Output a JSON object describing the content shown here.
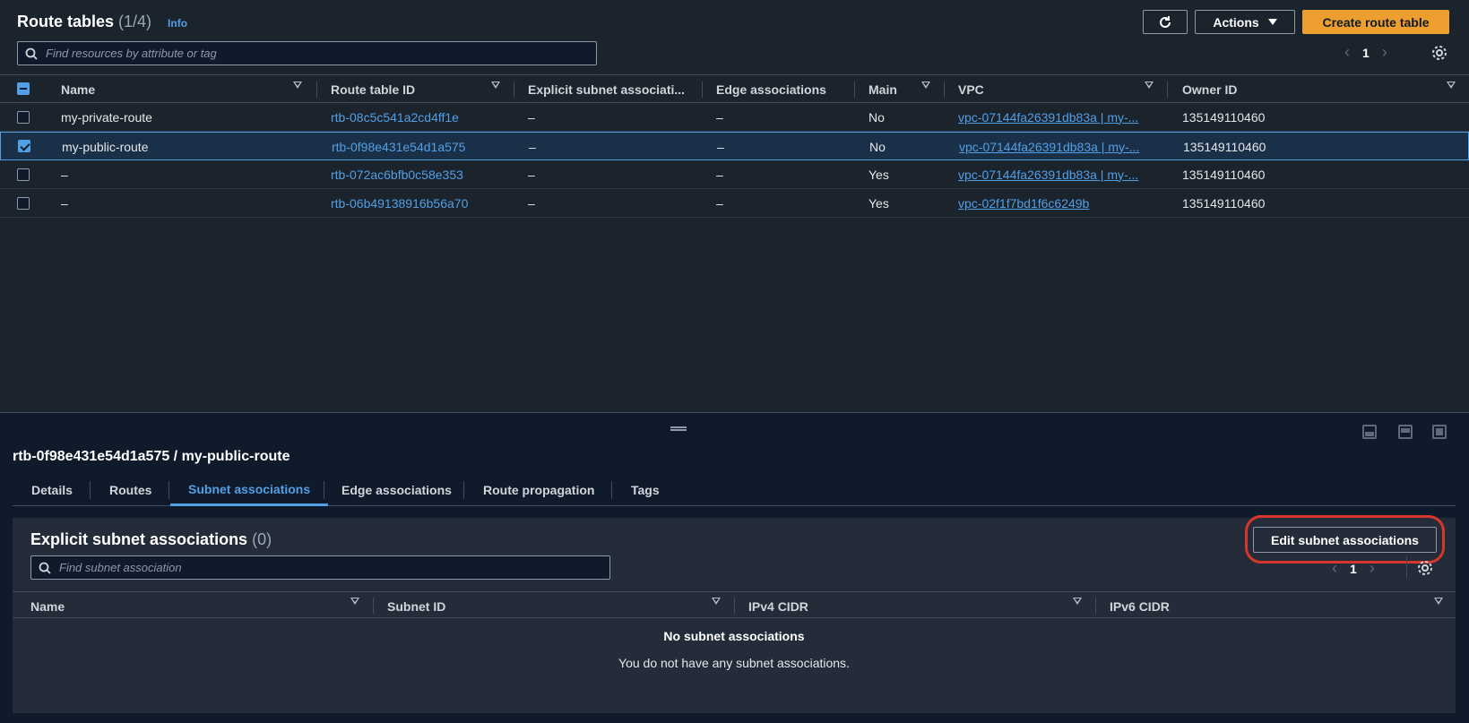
{
  "header": {
    "title": "Route tables",
    "count": "(1/4)",
    "info": "Info",
    "actions_label": "Actions",
    "create_label": "Create route table",
    "search_placeholder": "Find resources by attribute or tag",
    "page_number": "1"
  },
  "table": {
    "columns": [
      "Name",
      "Route table ID",
      "Explicit subnet associati...",
      "Edge associations",
      "Main",
      "VPC",
      "Owner ID"
    ],
    "rows": [
      {
        "name": "my-private-route",
        "id": "rtb-08c5c541a2cd4ff1e",
        "explicit": "–",
        "edge": "–",
        "main": "No",
        "vpc": "vpc-07144fa26391db83a | my-...",
        "owner": "135149110460",
        "selected": false
      },
      {
        "name": "my-public-route",
        "id": "rtb-0f98e431e54d1a575",
        "explicit": "–",
        "edge": "–",
        "main": "No",
        "vpc": "vpc-07144fa26391db83a | my-...",
        "owner": "135149110460",
        "selected": true
      },
      {
        "name": "–",
        "id": "rtb-072ac6bfb0c58e353",
        "explicit": "–",
        "edge": "–",
        "main": "Yes",
        "vpc": "vpc-07144fa26391db83a | my-...",
        "owner": "135149110460",
        "selected": false
      },
      {
        "name": "–",
        "id": "rtb-06b49138916b56a70",
        "explicit": "–",
        "edge": "–",
        "main": "Yes",
        "vpc": "vpc-02f1f7bd1f6c6249b",
        "owner": "135149110460",
        "selected": false
      }
    ]
  },
  "detail": {
    "title": "rtb-0f98e431e54d1a575 / my-public-route",
    "tabs": [
      "Details",
      "Routes",
      "Subnet associations",
      "Edge associations",
      "Route propagation",
      "Tags"
    ],
    "active_tab": "Subnet associations",
    "section_title": "Explicit subnet associations",
    "section_count": "(0)",
    "edit_label": "Edit subnet associations",
    "search_placeholder": "Find subnet association",
    "page_number": "1",
    "columns": [
      "Name",
      "Subnet ID",
      "IPv4 CIDR",
      "IPv6 CIDR"
    ],
    "empty_title": "No subnet associations",
    "empty_text": "You do not have any subnet associations."
  },
  "colors": {
    "accent": "#539fe5",
    "primary_button": "#ec9e2f",
    "highlight": "#d7362c"
  }
}
